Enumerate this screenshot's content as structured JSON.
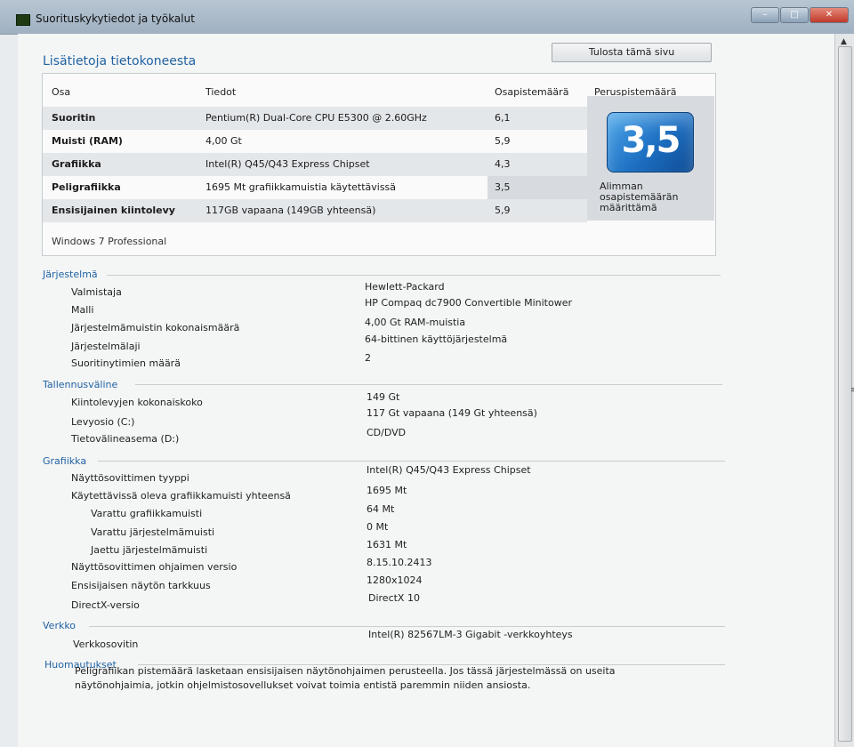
{
  "window": {
    "title": "Suorituskykytiedot ja työkalut",
    "buttons": {
      "minimize": "–",
      "maximize": "□",
      "close": "✕"
    }
  },
  "header": {
    "title": "Lisätietoja tietokoneesta",
    "print_label": "Tulosta tämä sivu"
  },
  "scores": {
    "headers": {
      "component": "Osa",
      "details": "Tiedot",
      "subscore": "Osapistemäärä",
      "base": "Peruspistemäärä"
    },
    "rows": [
      {
        "component": "Suoritin",
        "details": "Pentium(R) Dual-Core CPU E5300 @ 2.60GHz",
        "score": "6,1"
      },
      {
        "component": "Muisti (RAM)",
        "details": "4,00 Gt",
        "score": "5,9"
      },
      {
        "component": "Grafiikka",
        "details": "Intel(R) Q45/Q43 Express Chipset",
        "score": "4,3"
      },
      {
        "component": "Peligrafiikka",
        "details": "1695 Mt grafiikkamuistia käytettävissä",
        "score": "3,5"
      },
      {
        "component": "Ensisijainen kiintolevy",
        "details": "117GB vapaana (149GB yhteensä)",
        "score": "5,9"
      }
    ],
    "base_score": "3,5",
    "base_caption": "Alimman osapistemäärän määrittämä",
    "windows_edition": "Windows 7 Professional"
  },
  "system": {
    "title": "Järjestelmä",
    "items": [
      {
        "label": "Valmistaja",
        "value": "Hewlett-Packard"
      },
      {
        "label": "Malli",
        "value": "HP Compaq dc7900 Convertible Minitower"
      },
      {
        "label": "Järjestelmämuistin kokonaismäärä",
        "value": "4,00 Gt RAM-muistia"
      },
      {
        "label": "Järjestelmälaji",
        "value": "64-bittinen käyttöjärjestelmä"
      },
      {
        "label": "Suoritinytimien määrä",
        "value": "2"
      }
    ]
  },
  "storage": {
    "title": "Tallennusväline",
    "items": [
      {
        "label": "Kiintolevyjen kokonaiskoko",
        "value": "149 Gt"
      },
      {
        "label": "Levyosio (C:)",
        "value": "117 Gt vapaana (149 Gt yhteensä)"
      },
      {
        "label": "Tietovälineasema (D:)",
        "value": "CD/DVD"
      }
    ]
  },
  "graphics": {
    "title": "Grafiikka",
    "items": [
      {
        "label": "Näyttösovittimen tyyppi",
        "value": "Intel(R) Q45/Q43 Express Chipset"
      },
      {
        "label": "Käytettävissä oleva grafiikkamuisti yhteensä",
        "value": "1695 Mt"
      },
      {
        "label": "Varattu grafiikkamuisti",
        "value": "64 Mt"
      },
      {
        "label": "Varattu järjestelmämuisti",
        "value": "0 Mt"
      },
      {
        "label": "Jaettu järjestelmämuisti",
        "value": "1631 Mt"
      },
      {
        "label": "Näyttösovittimen ohjaimen versio",
        "value": "8.15.10.2413"
      },
      {
        "label": "Ensisijaisen näytön tarkkuus",
        "value": "1280x1024"
      },
      {
        "label": "DirectX-versio",
        "value": "DirectX 10"
      }
    ]
  },
  "network": {
    "title": "Verkko",
    "items": [
      {
        "label": "Verkkosovitin",
        "value": "Intel(R) 82567LM-3 Gigabit -verkkoyhteys"
      }
    ]
  },
  "notes": {
    "title": "Huomautukset",
    "line1": "Peligrafiikan pistemäärä lasketaan ensisijaisen näytönohjaimen perusteella. Jos tässä järjestelmässä on useita",
    "line2": "näytönohjaimia, jotkin ohjelmistosovellukset voivat toimia entistä paremmin niiden ansiosta."
  }
}
